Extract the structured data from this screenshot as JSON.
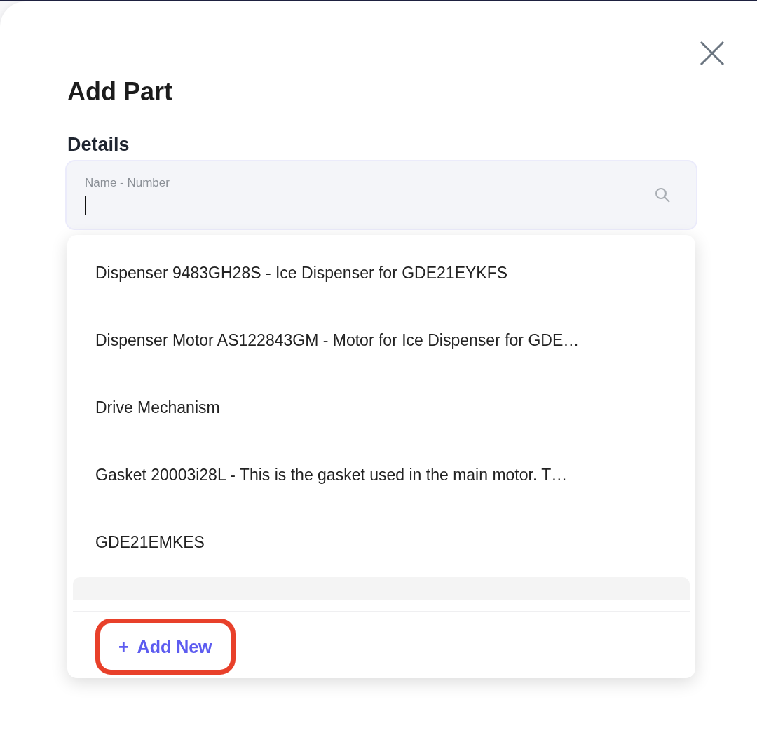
{
  "dialog": {
    "title": "Add Part",
    "section": "Details"
  },
  "field": {
    "label": "Name - Number",
    "focused": true
  },
  "options": [
    {
      "label": "Dispenser 9483GH28S - Ice Dispenser for GDE21EYKFS"
    },
    {
      "label": "Dispenser Motor AS122843GM - Motor for Ice Dispenser for GDE…"
    },
    {
      "label": "Drive Mechanism"
    },
    {
      "label": "Gasket 20003i28L - This is the gasket used in the main motor. T…"
    },
    {
      "label": "GDE21EMKES"
    }
  ],
  "add_new": {
    "icon": "+",
    "label": "Add New",
    "highlighted": true
  }
}
